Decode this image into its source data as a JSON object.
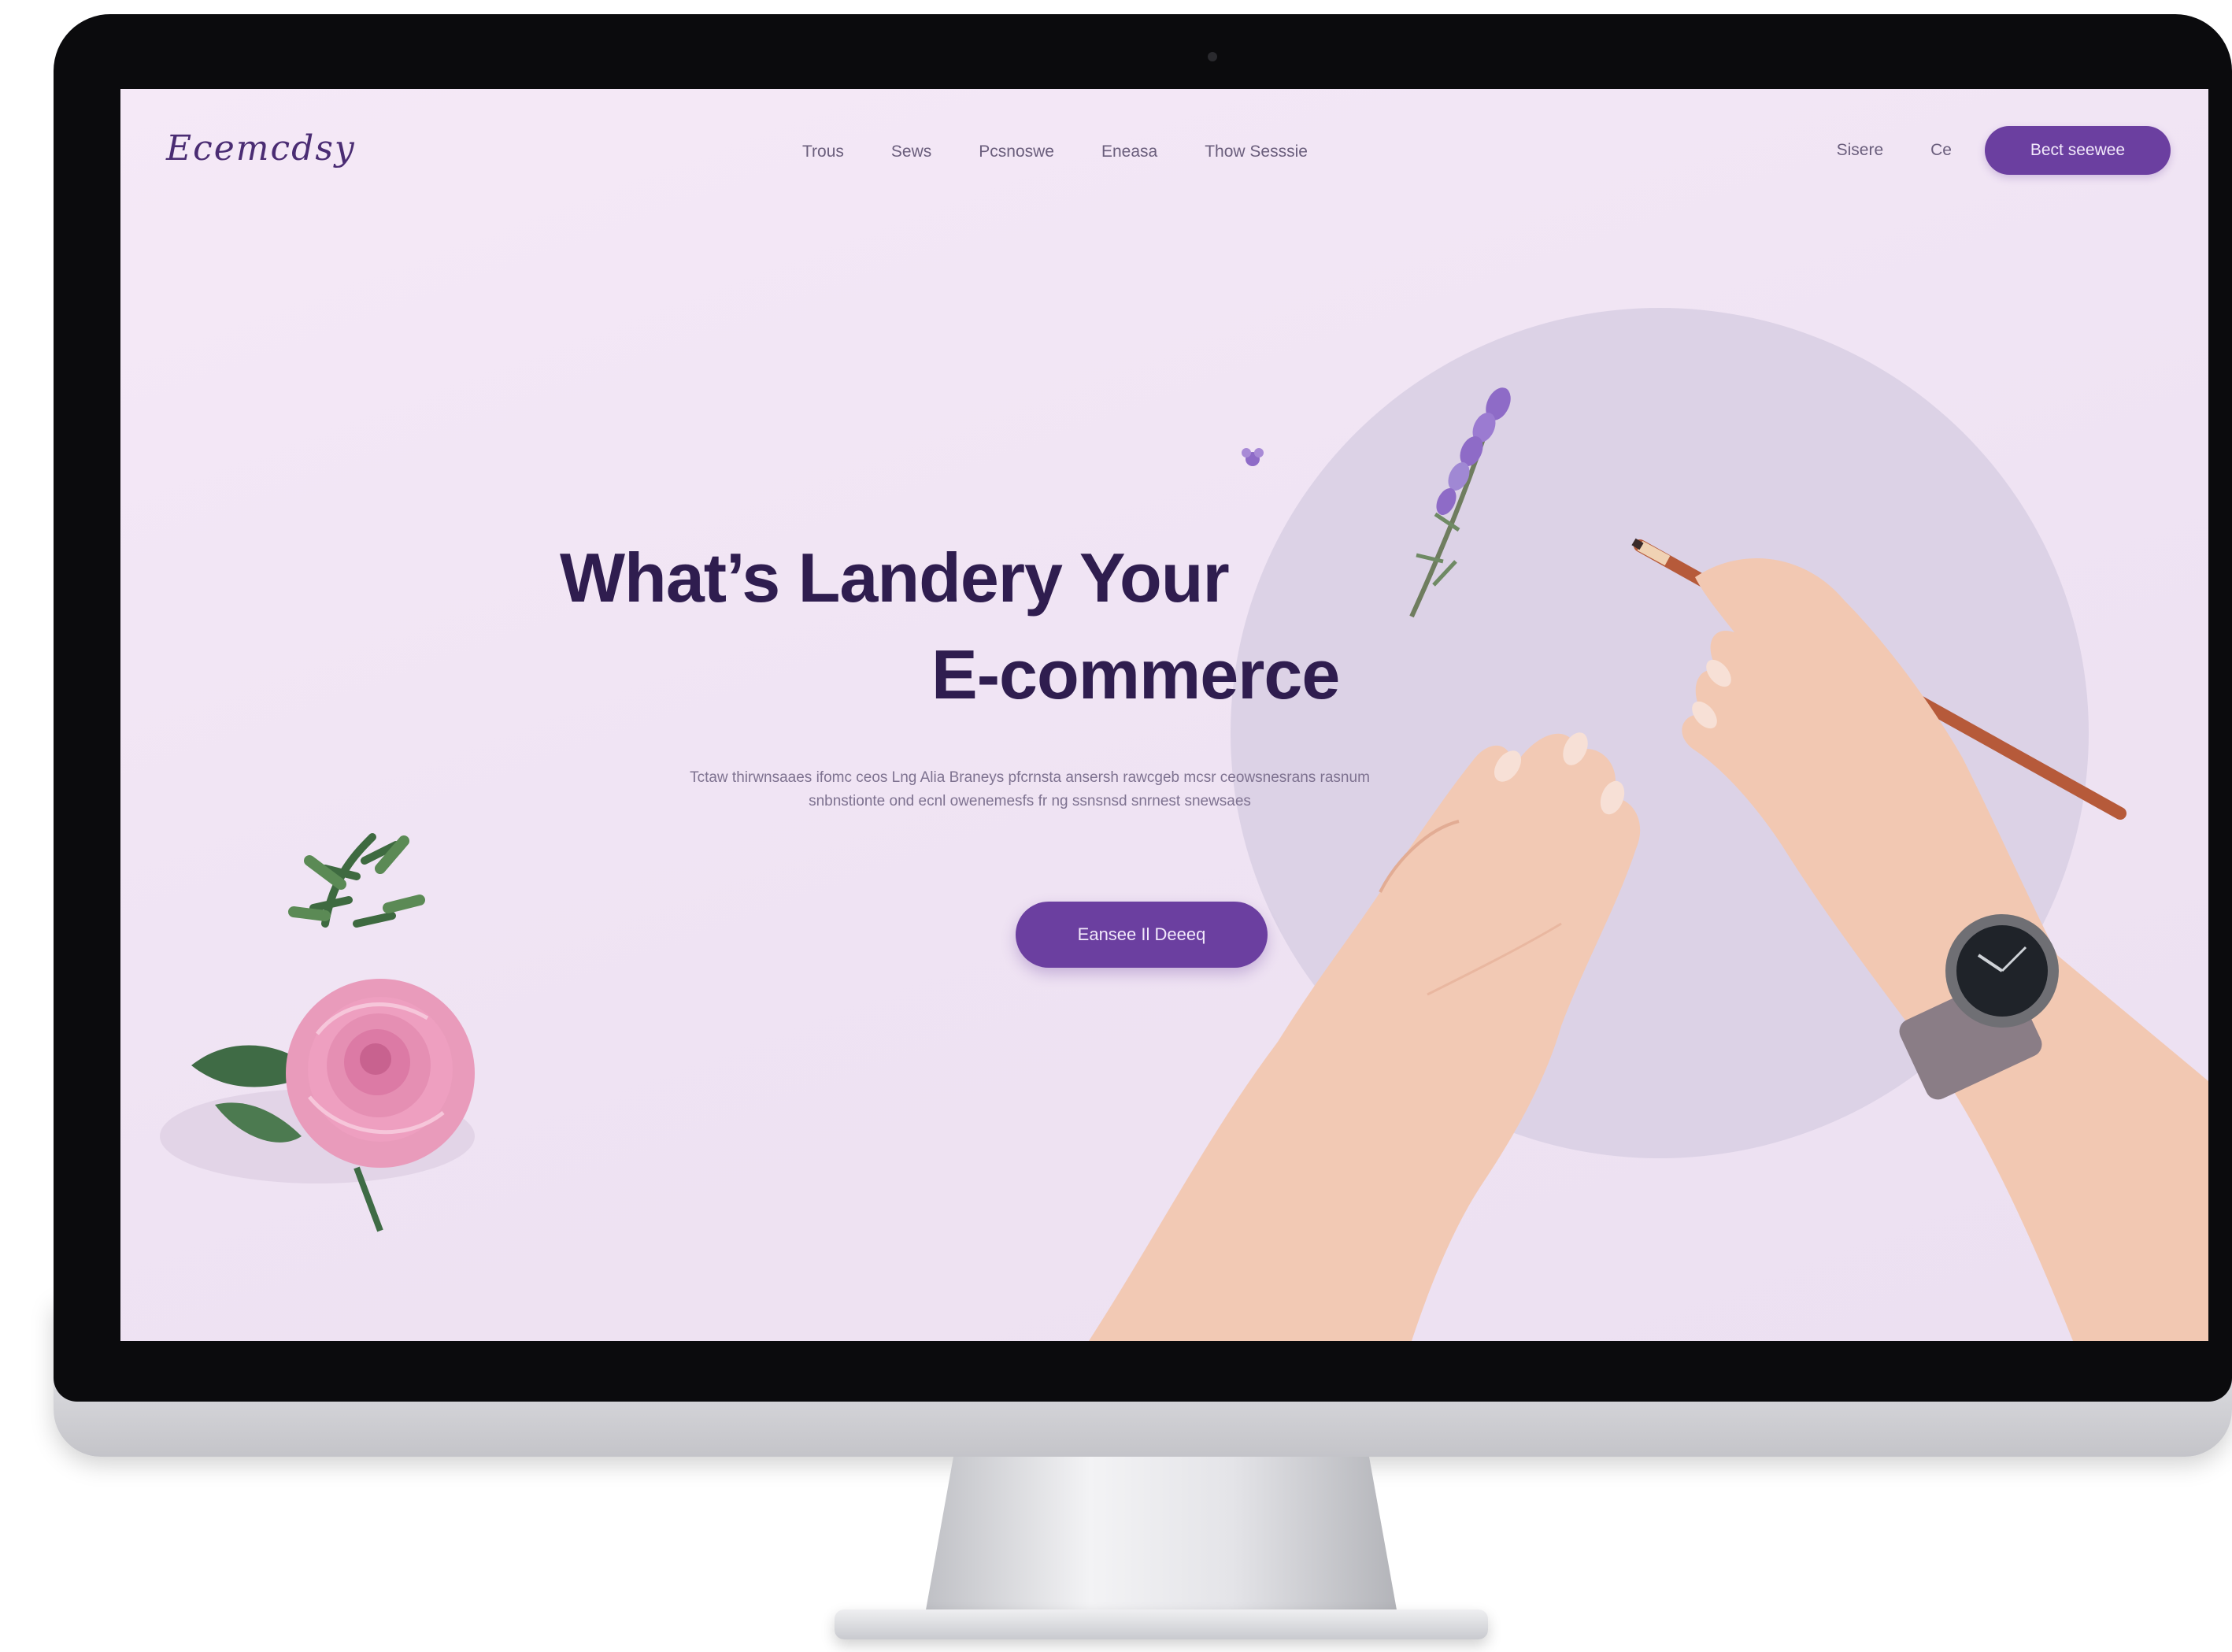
{
  "site": {
    "logo": "Ecemcdsy",
    "nav": {
      "links": [
        "Trous",
        "Sews",
        "Pcsnoswe",
        "Eneasa",
        "Thow Sesssie"
      ],
      "login": "Sisere",
      "cart": "Ce",
      "cta": "Bect seewee"
    }
  },
  "hero": {
    "title_line1": "What’s Landery Your",
    "title_line2": "E-commerce",
    "subtitle": "Tctaw thirwnsaaes ifomc ceos Lng Alia Braneys pfcrnsta ansersh rawcgeb mcsr ceowsnesrans rasnum snbnstionte ond ecnl owenemesfs fr ng ssnsnsd snrnest snewsaes",
    "cta": "Eansee Il Deeeq"
  },
  "colors": {
    "accent": "#6b3fa0",
    "heading": "#2f1d4f",
    "background": "#f3e7f6",
    "circle": "#dcd2e6",
    "rose": "#e58fb3",
    "lavender": "#8e6bc7"
  },
  "icons": [
    "rose-icon",
    "lavender-icon",
    "pencil-icon",
    "hand-icon",
    "watch-icon"
  ]
}
